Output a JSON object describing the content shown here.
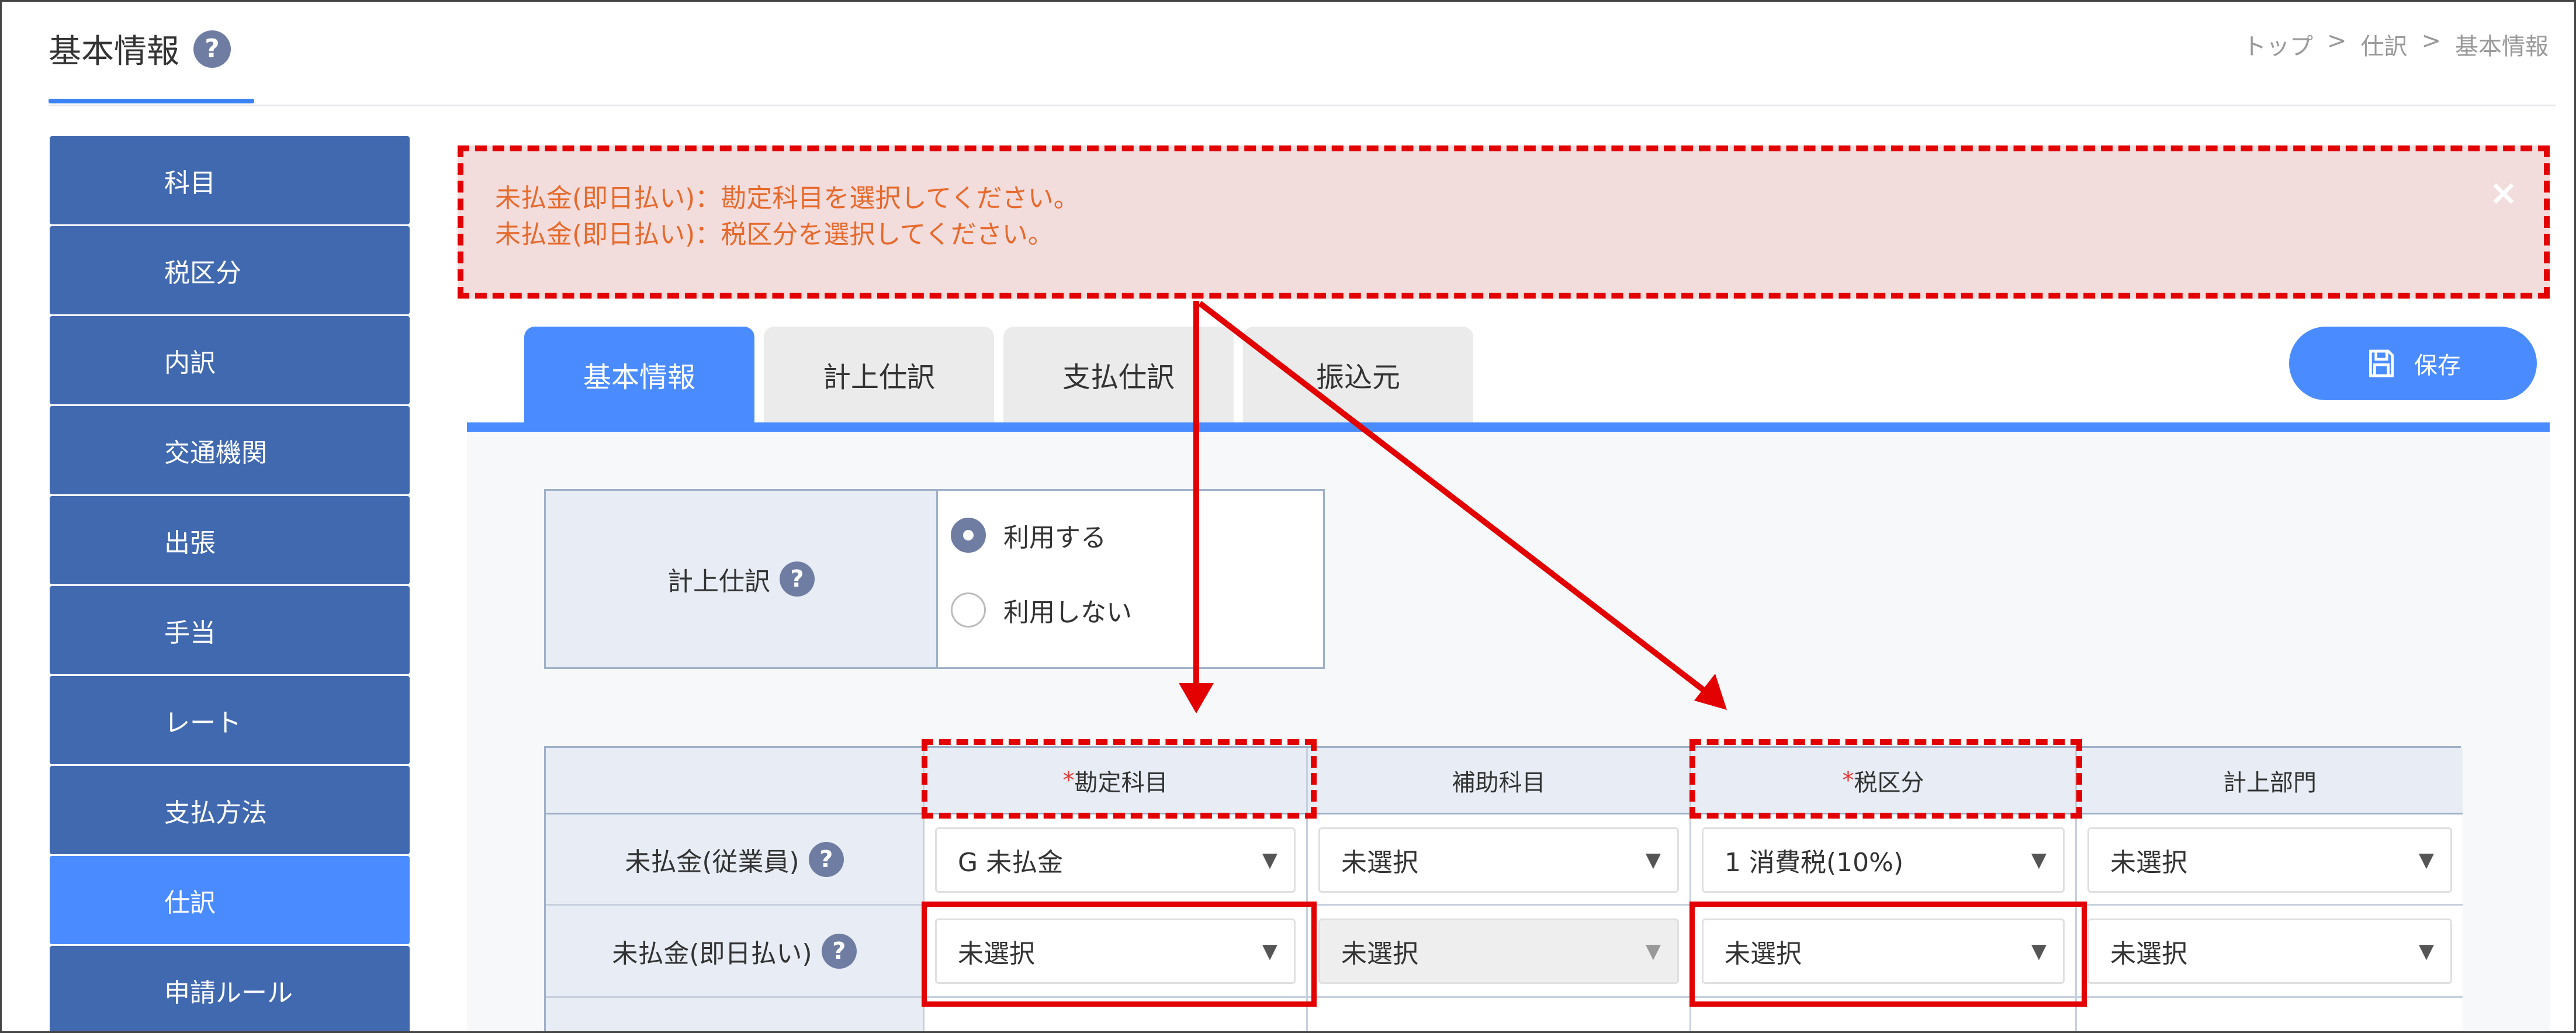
{
  "header": {
    "title": "基本情報",
    "help_icon": "?",
    "breadcrumb": [
      "トップ",
      ">",
      "仕訳",
      ">",
      "基本情報"
    ]
  },
  "sidebar": {
    "items": [
      {
        "label": "科目"
      },
      {
        "label": "税区分"
      },
      {
        "label": "内訳"
      },
      {
        "label": "交通機関"
      },
      {
        "label": "出張"
      },
      {
        "label": "手当"
      },
      {
        "label": "レート"
      },
      {
        "label": "支払方法"
      },
      {
        "label": "仕訳",
        "active": true
      },
      {
        "label": "申請ルール"
      }
    ]
  },
  "alert": {
    "lines": [
      "未払金(即日払い)：勘定科目を選択してください。",
      "未払金(即日払い)：税区分を選択してください。"
    ],
    "close": "×"
  },
  "tabs": [
    {
      "label": "基本情報",
      "active": true
    },
    {
      "label": "計上仕訳"
    },
    {
      "label": "支払仕訳"
    },
    {
      "label": "振込元"
    }
  ],
  "save_button": {
    "label": "保存",
    "icon": "save-icon"
  },
  "journal_setting": {
    "label": "計上仕訳",
    "help": "?",
    "options": [
      {
        "label": "利用する",
        "selected": true
      },
      {
        "label": "利用しない",
        "selected": false
      }
    ]
  },
  "table": {
    "columns": [
      {
        "label": "勘定科目",
        "required_mark": "*"
      },
      {
        "label": "補助科目",
        "required_mark": ""
      },
      {
        "label": "税区分",
        "required_mark": "*"
      },
      {
        "label": "計上部門",
        "required_mark": ""
      }
    ],
    "rows": [
      {
        "label": "未払金(従業員)",
        "help": "?",
        "cells": [
          "G 未払金",
          "未選択",
          "1 消費税(10%)",
          "未選択"
        ]
      },
      {
        "label": "未払金(即日払い)",
        "help": "?",
        "cells": [
          "未選択",
          "未選択",
          "未選択",
          "未選択"
        ]
      }
    ],
    "caret": "▼"
  },
  "colors": {
    "accent": "#4a8cff",
    "sidebar": "#4169b0",
    "annotation_red": "#e20000",
    "alert_bg": "#f3dcdc",
    "alert_text": "#e66a2c"
  }
}
